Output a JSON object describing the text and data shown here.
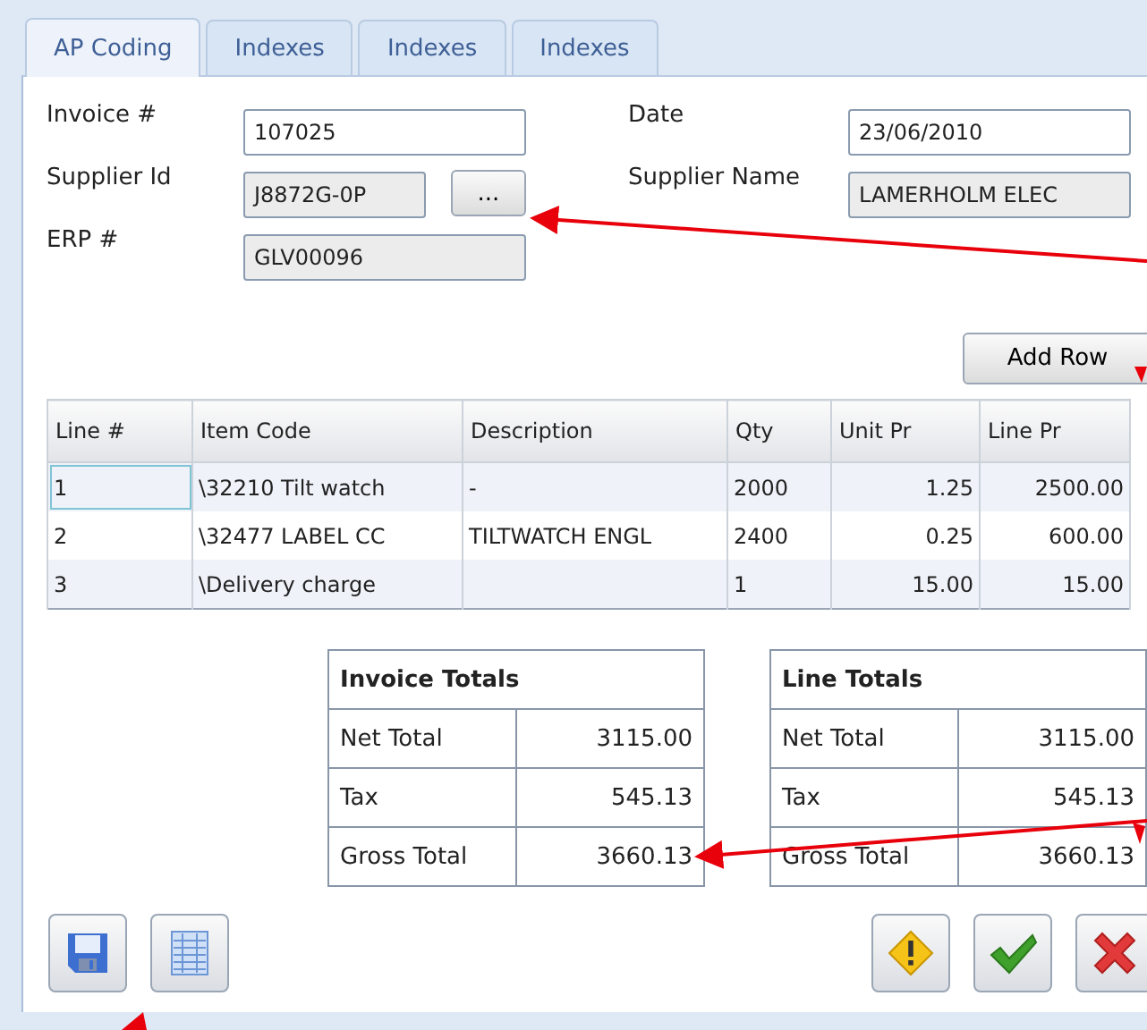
{
  "tabs": [
    {
      "label": "AP Coding",
      "selected": true
    },
    {
      "label": "Indexes",
      "selected": false
    },
    {
      "label": "Indexes",
      "selected": false
    },
    {
      "label": "Indexes",
      "selected": false
    }
  ],
  "fields": [
    {
      "label": "Invoice #",
      "value": "107025",
      "readonly": false
    },
    {
      "label": "Date",
      "value": "23/06/2010",
      "readonly": false
    },
    {
      "label": "Supplier Id",
      "value": "J8872G-0P",
      "readonly": true,
      "browse_button": "..."
    },
    {
      "label": "Supplier Name",
      "value": "LAMERHOLM ELEC",
      "readonly": true
    },
    {
      "label": "ERP #",
      "value": "GLV00096",
      "readonly": true
    }
  ],
  "add_row_button": "Add Row",
  "table": {
    "columns": [
      "Line #",
      "Item Code",
      "Description",
      "Qty",
      "Unit Pr",
      "Line Pr"
    ],
    "rows": [
      [
        "1",
        "\\32210 Tilt watch",
        "-",
        "2000",
        "1.25",
        "2500.00"
      ],
      [
        "2",
        "\\32477  LABEL CC",
        "TILTWATCH ENGL",
        "2400",
        "0.25",
        "600.00"
      ],
      [
        "3",
        "\\Delivery charge",
        "",
        "1",
        "15.00",
        "15.00"
      ]
    ]
  },
  "totals": [
    {
      "title": "Invoice Totals",
      "rows": [
        [
          "Net Total",
          "3115.00"
        ],
        [
          "Tax",
          "545.13"
        ],
        [
          "Gross Total",
          "3660.13"
        ]
      ]
    },
    {
      "title": "Line Totals",
      "rows": [
        [
          "Net Total",
          "3115.00"
        ],
        [
          "Tax",
          "545.13"
        ],
        [
          "Gross Total",
          "3660.13"
        ]
      ]
    }
  ],
  "left_buttons": [
    {
      "kind": "save"
    },
    {
      "kind": "list"
    }
  ],
  "right_buttons": [
    {
      "kind": "warning"
    },
    {
      "kind": "approve"
    },
    {
      "kind": "reject"
    }
  ]
}
